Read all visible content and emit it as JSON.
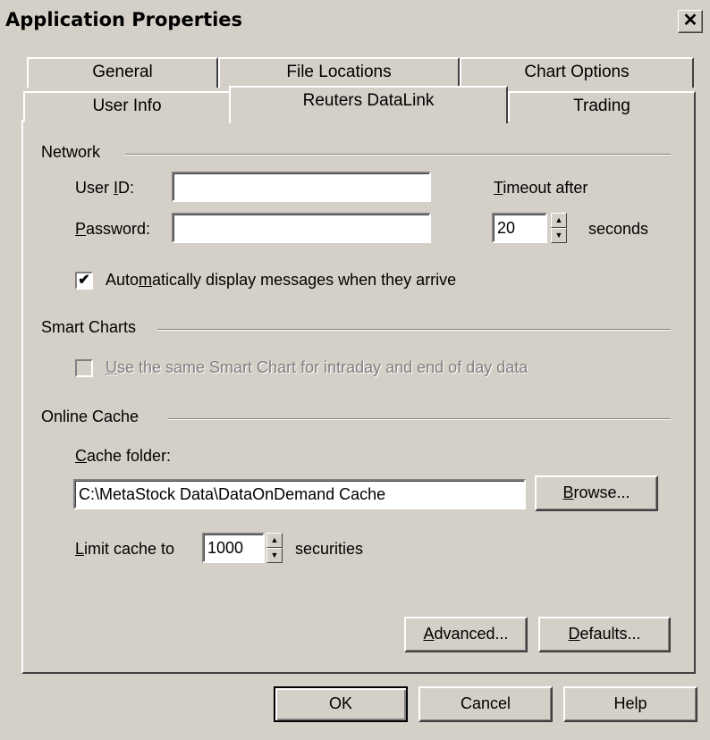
{
  "window": {
    "title": "Application Properties",
    "close_glyph": "✕"
  },
  "tabs": {
    "row1": [
      {
        "label": "General"
      },
      {
        "label": "File Locations"
      },
      {
        "label": "Chart Options"
      }
    ],
    "row2": [
      {
        "label": "User Info"
      },
      {
        "label": "Reuters DataLink",
        "active": true
      },
      {
        "label": "Trading"
      }
    ]
  },
  "network": {
    "group_label": "Network",
    "user_id_label_pre": "User ",
    "user_id_label_ul": "I",
    "user_id_label_post": "D:",
    "user_id_value": "",
    "password_label_ul": "P",
    "password_label_post": "assword:",
    "password_value": "",
    "timeout_label_ul": "T",
    "timeout_label_post": "imeout after",
    "timeout_value": "20",
    "timeout_unit": "seconds",
    "auto_display_checked": true,
    "auto_display_pre": "Auto",
    "auto_display_ul": "m",
    "auto_display_post": "atically display messages when they arrive"
  },
  "smart_charts": {
    "group_label": "Smart Charts",
    "same_chart_checked": false,
    "same_chart_ul": "U",
    "same_chart_post": "se the same Smart Chart for intraday and end of day data"
  },
  "online_cache": {
    "group_label": "Online Cache",
    "folder_label_ul": "C",
    "folder_label_post": "ache folder:",
    "folder_value": "C:\\MetaStock Data\\DataOnDemand Cache",
    "browse_ul": "B",
    "browse_post": "rowse...",
    "limit_label_ul": "L",
    "limit_label_post": "imit cache to",
    "limit_value": "1000",
    "limit_unit": "securities"
  },
  "panel_buttons": {
    "advanced_ul": "A",
    "advanced_post": "dvanced...",
    "defaults_ul": "D",
    "defaults_post": "efaults..."
  },
  "dialog_buttons": {
    "ok": "OK",
    "cancel": "Cancel",
    "help": "Help"
  },
  "icons": {
    "spin_up": "▲",
    "spin_down": "▼",
    "check_mark": "✔"
  }
}
